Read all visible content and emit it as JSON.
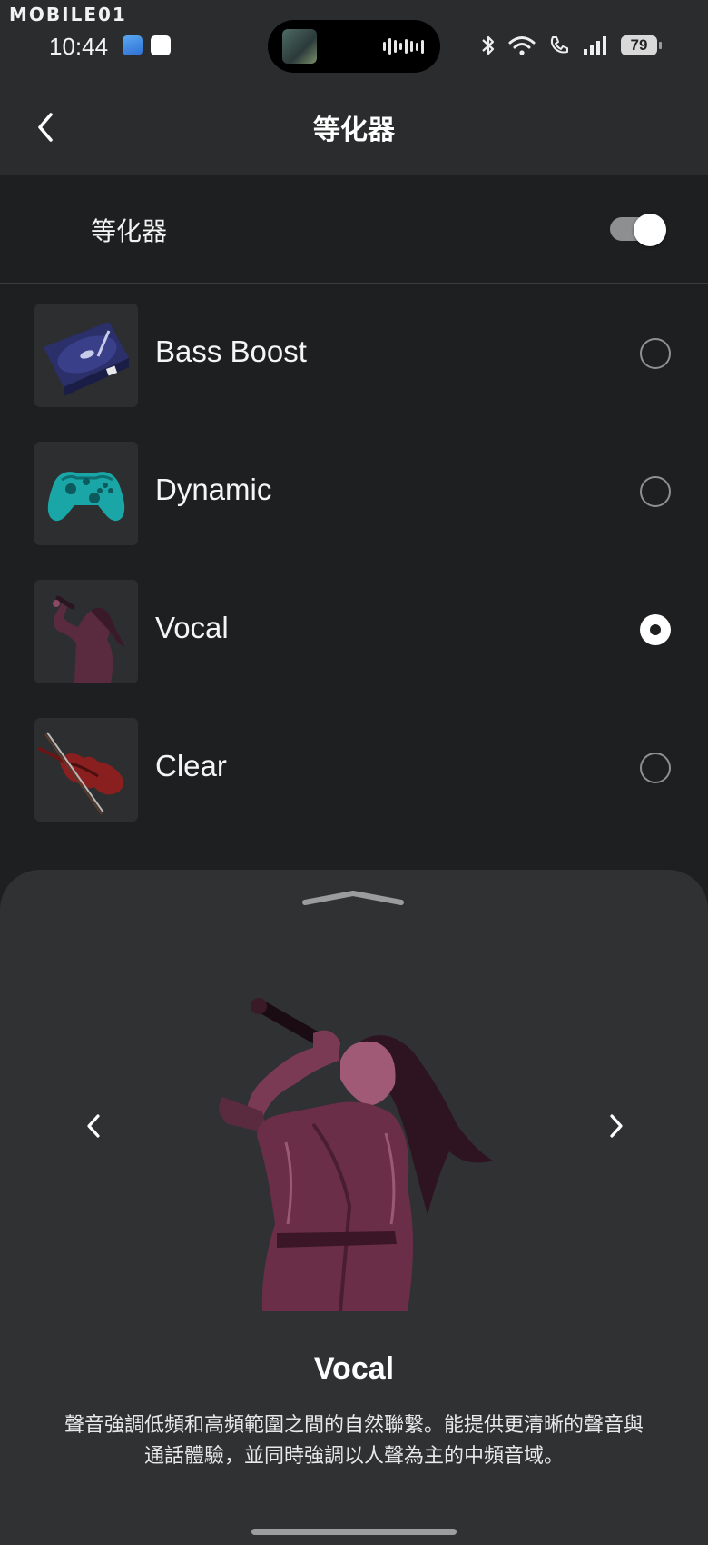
{
  "status_bar": {
    "watermark": "MOBILE01",
    "time": "10:44",
    "battery": "79"
  },
  "header": {
    "title": "等化器"
  },
  "equalizer_toggle": {
    "label": "等化器",
    "enabled": true
  },
  "presets": [
    {
      "label": "Bass Boost",
      "icon": "turntable-icon",
      "selected": false
    },
    {
      "label": "Dynamic",
      "icon": "game-controller-icon",
      "selected": false
    },
    {
      "label": "Vocal",
      "icon": "singer-icon",
      "selected": true
    },
    {
      "label": "Clear",
      "icon": "violin-icon",
      "selected": false
    }
  ],
  "detail": {
    "title": "Vocal",
    "description": "聲音強調低頻和高頻範圍之間的自然聯繫。能提供更清晰的聲音與通話體驗，並同時強調以人聲為主的中頻音域。",
    "hero_icon": "singer-illustration"
  },
  "colors": {
    "background": "#1d1f20",
    "header": "#2a2c2e",
    "sheet": "#2f3133",
    "tint": "#7a2f4a"
  }
}
